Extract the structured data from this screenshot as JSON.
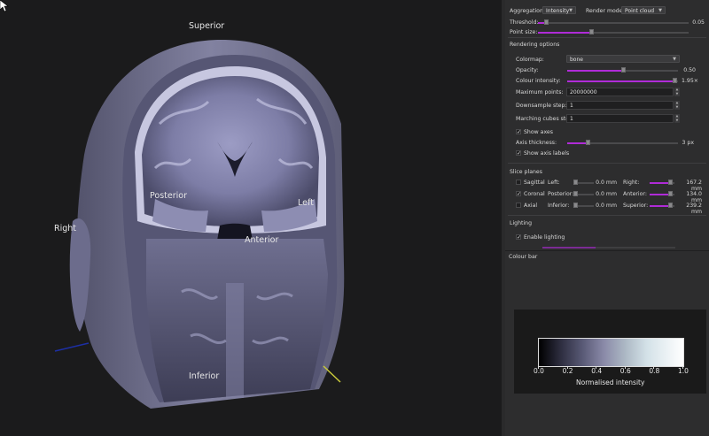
{
  "viewport": {
    "orientation_labels": {
      "superior": "Superior",
      "posterior": "Posterior",
      "left": "Left",
      "right": "Right",
      "anterior": "Anterior",
      "inferior": "Inferior"
    }
  },
  "controls": {
    "aggregation_label": "Aggregation:",
    "aggregation_value": "Intensity",
    "render_mode_label": "Render mode:",
    "render_mode_value": "Point cloud",
    "threshold_label": "Threshold:",
    "threshold_value": "0.05",
    "threshold_fraction": 0.05,
    "point_size_label": "Point size:",
    "point_size_fraction": 0.35
  },
  "rendering": {
    "section_title": "Rendering options",
    "colormap_label": "Colormap:",
    "colormap_value": "bone",
    "opacity_label": "Opacity:",
    "opacity_value": "0.50",
    "opacity_fraction": 0.5,
    "colour_intensity_label": "Colour intensity:",
    "colour_intensity_value": "1.95×",
    "colour_intensity_fraction": 0.97,
    "max_points_label": "Maximum points:",
    "max_points_value": "20000000",
    "downsample_label": "Downsample step:",
    "downsample_value": "1",
    "marching_label": "Marching cubes step:",
    "marching_value": "1",
    "show_axes_label": "Show axes",
    "show_axes_checked": true,
    "axis_thickness_label": "Axis thickness:",
    "axis_thickness_value": "3 px",
    "axis_thickness_fraction": 0.18,
    "show_axis_labels_label": "Show axis labels",
    "show_axis_labels_checked": true
  },
  "slices": {
    "section_title": "Slice planes",
    "rows": [
      {
        "name": "Sagittal",
        "checked": false,
        "from_label": "Left:",
        "from_value": "0.0 mm",
        "to_label": "Right:",
        "to_value": "167.2 mm"
      },
      {
        "name": "Coronal",
        "checked": true,
        "from_label": "Posterior:",
        "from_value": "0.0 mm",
        "to_label": "Anterior:",
        "to_value": "134.0 mm"
      },
      {
        "name": "Axial",
        "checked": false,
        "from_label": "Inferior:",
        "from_value": "0.0 mm",
        "to_label": "Superior:",
        "to_value": "239.2 mm"
      }
    ]
  },
  "lighting": {
    "section_title": "Lighting",
    "enable_label": "Enable lighting",
    "enable_checked": true
  },
  "colour_bar": {
    "section_title": "Colour bar",
    "ticks": [
      "0.0",
      "0.2",
      "0.4",
      "0.6",
      "0.8",
      "1.0"
    ],
    "xlabel": "Normalised intensity"
  },
  "colors": {
    "accent": "#b02bd8",
    "panel_bg": "#2d2d2e",
    "viewport_bg": "#1b1b1c"
  }
}
